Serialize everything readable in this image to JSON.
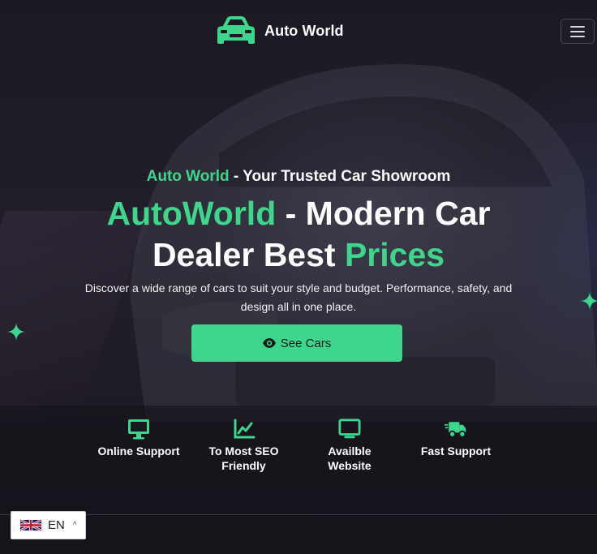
{
  "header": {
    "brand_name": "Auto World",
    "brand_icon": "car-icon",
    "menu_icon": "hamburger-menu-icon"
  },
  "hero": {
    "tagline_accent": "Auto World",
    "tagline_rest": " - Your Trusted Car Showroom",
    "headline_part1": "AutoWorld",
    "headline_part2": " - Modern Car",
    "headline_part3": "Dealer Best ",
    "headline_part4": "Prices",
    "subtext": "Discover a wide range of cars to suit your style and budget. Performance, safety, and design all in one place.",
    "cta_label": "See Cars",
    "cta_icon": "eye-icon"
  },
  "features": [
    {
      "line1": "Online Support",
      "line2": "",
      "icon": "monitor-icon"
    },
    {
      "line1": "To Most SEO",
      "line2": "Friendly",
      "icon": "chart-line-icon"
    },
    {
      "line1": "Availble",
      "line2": "Website",
      "icon": "laptop-icon"
    },
    {
      "line1": "Fast Support",
      "line2": "",
      "icon": "truck-fast-icon"
    }
  ],
  "language": {
    "code": "EN",
    "flag": "uk-flag-icon",
    "caret": "^"
  },
  "colors": {
    "accent": "#3dd68c",
    "background": "#1a1620",
    "text": "#ffffff"
  }
}
